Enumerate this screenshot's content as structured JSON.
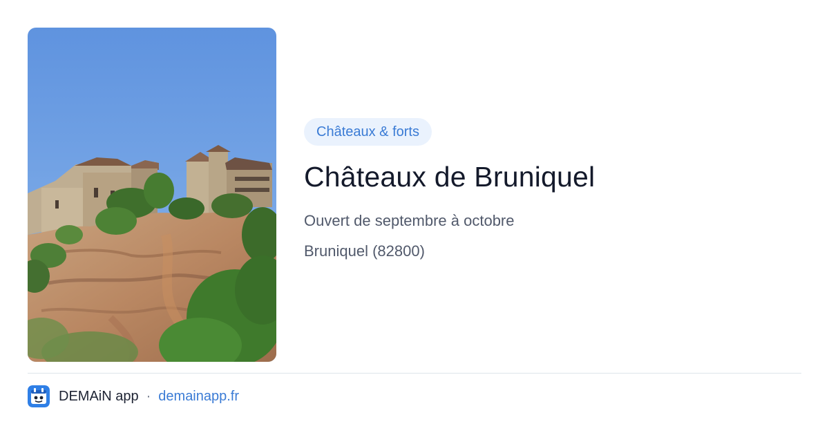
{
  "card": {
    "category": "Châteaux & forts",
    "title": "Châteaux de Bruniquel",
    "subtitle": "Ouvert de septembre à octobre",
    "location": "Bruniquel (82800)"
  },
  "footer": {
    "app_name": "DEMAiN app",
    "separator": "·",
    "site": "demainapp.fr"
  },
  "photo": {
    "subject": "castle on limestone cliff under blue sky"
  },
  "colors": {
    "accent": "#3a7bd5",
    "tag_bg": "#eaf2fd",
    "title": "#141a2b",
    "muted": "#51596b",
    "divider": "#dde4ea"
  }
}
